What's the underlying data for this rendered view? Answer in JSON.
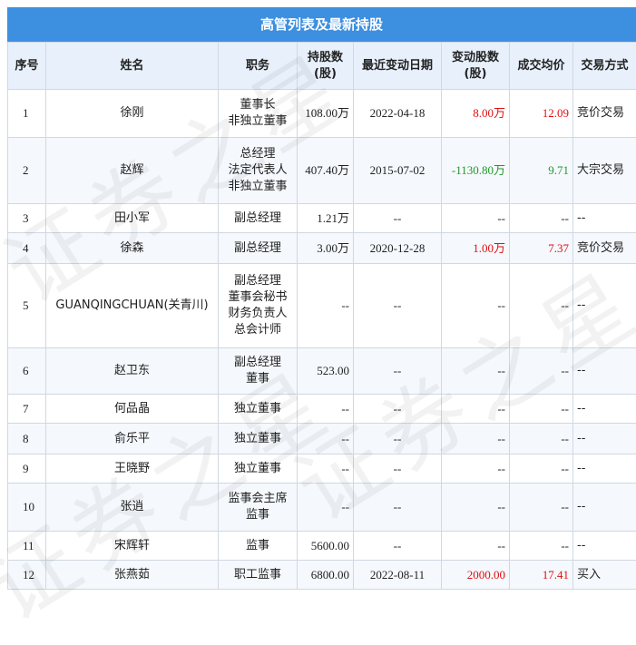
{
  "title": "高管列表及最新持股",
  "headers": {
    "seq": "序号",
    "name": "姓名",
    "position": "职务",
    "holding_1": "持股数",
    "holding_2": "(股)",
    "date": "最近变动日期",
    "change_1": "变动股数",
    "change_2": "(股)",
    "price": "成交均价",
    "mode": "交易方式"
  },
  "rows": [
    {
      "seq": "1",
      "name": "徐刚",
      "position": [
        "董事长",
        "非独立董事"
      ],
      "holding": "108.00万",
      "date": "2022-04-18",
      "change": "8.00万",
      "change_color": "red",
      "price": "12.09",
      "price_color": "red",
      "mode": "竞价交易"
    },
    {
      "seq": "2",
      "name": "赵辉",
      "position": [
        "总经理",
        "法定代表人",
        "非独立董事"
      ],
      "holding": "407.40万",
      "date": "2015-07-02",
      "change": "-1130.80万",
      "change_color": "green",
      "price": "9.71",
      "price_color": "green",
      "mode": "大宗交易"
    },
    {
      "seq": "3",
      "name": "田小军",
      "position": [
        "副总经理"
      ],
      "holding": "1.21万",
      "date": "--",
      "change": "--",
      "change_color": "",
      "price": "--",
      "price_color": "",
      "mode": "--"
    },
    {
      "seq": "4",
      "name": "徐森",
      "position": [
        "副总经理"
      ],
      "holding": "3.00万",
      "date": "2020-12-28",
      "change": "1.00万",
      "change_color": "red",
      "price": "7.37",
      "price_color": "red",
      "mode": "竞价交易"
    },
    {
      "seq": "5",
      "name": "GUANQINGCHUAN(关青川)",
      "position": [
        "副总经理",
        "董事会秘书",
        "财务负责人",
        "总会计师"
      ],
      "holding": "--",
      "date": "--",
      "change": "--",
      "change_color": "",
      "price": "--",
      "price_color": "",
      "mode": "--"
    },
    {
      "seq": "6",
      "name": "赵卫东",
      "position": [
        "副总经理",
        "董事"
      ],
      "holding": "523.00",
      "date": "--",
      "change": "--",
      "change_color": "",
      "price": "--",
      "price_color": "",
      "mode": "--"
    },
    {
      "seq": "7",
      "name": "何品晶",
      "position": [
        "独立董事"
      ],
      "holding": "--",
      "date": "--",
      "change": "--",
      "change_color": "",
      "price": "--",
      "price_color": "",
      "mode": "--"
    },
    {
      "seq": "8",
      "name": "俞乐平",
      "position": [
        "独立董事"
      ],
      "holding": "--",
      "date": "--",
      "change": "--",
      "change_color": "",
      "price": "--",
      "price_color": "",
      "mode": "--"
    },
    {
      "seq": "9",
      "name": "王晓野",
      "position": [
        "独立董事"
      ],
      "holding": "--",
      "date": "--",
      "change": "--",
      "change_color": "",
      "price": "--",
      "price_color": "",
      "mode": "--"
    },
    {
      "seq": "10",
      "name": "张逍",
      "position": [
        "监事会主席",
        "监事"
      ],
      "holding": "--",
      "date": "--",
      "change": "--",
      "change_color": "",
      "price": "--",
      "price_color": "",
      "mode": "--"
    },
    {
      "seq": "11",
      "name": "宋辉轩",
      "position": [
        "监事"
      ],
      "holding": "5600.00",
      "date": "--",
      "change": "--",
      "change_color": "",
      "price": "--",
      "price_color": "",
      "mode": "--"
    },
    {
      "seq": "12",
      "name": "张燕茹",
      "position": [
        "职工监事"
      ],
      "holding": "6800.00",
      "date": "2022-08-11",
      "change": "2000.00",
      "change_color": "red",
      "price": "17.41",
      "price_color": "red",
      "mode": "买入"
    }
  ],
  "colors": {
    "header_bg": "#3d8fe0",
    "red": "#e01010",
    "green": "#1f9a2b"
  },
  "watermark": "证券之星"
}
